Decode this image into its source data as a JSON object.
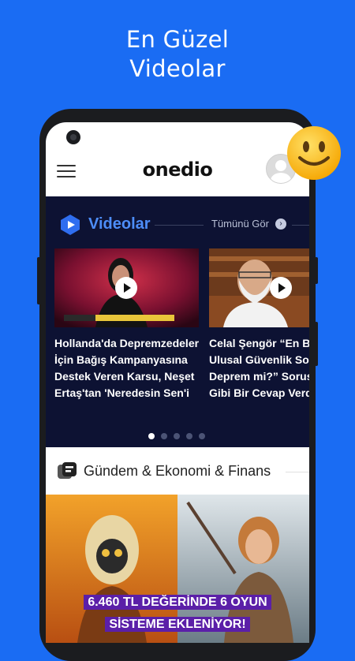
{
  "promo": {
    "line1": "En Güzel",
    "line2": "Videolar"
  },
  "app": {
    "logo": "onedio"
  },
  "videos": {
    "section_title": "Videolar",
    "see_all": "Tümünü Gör",
    "items": [
      {
        "title_lines": [
          "Hollanda'da Depremzedeler",
          "İçin Bağış Kampanyasına",
          "Destek Veren Karsu, Neşet",
          "Ertaş'tan 'Neredesin Sen'i"
        ]
      },
      {
        "title_lines": [
          "Celal Şengör “En Büyük",
          "Ulusal Güvenlik Sorunu",
          "Deprem mi?” Sorusuna",
          "Gibi Bir Cevap Verdi!"
        ]
      }
    ],
    "pager": {
      "count": 5,
      "active": 0
    }
  },
  "category": {
    "title": "Gündem & Ekonomi & Finans"
  },
  "banner": {
    "line1": "6.460 TL DEĞERİNDE 6 OYUN",
    "line2": "SİSTEME EKLENİYOR!"
  },
  "colors": {
    "background": "#1a6cf3",
    "section_dark": "#0d1233",
    "accent": "#4d8df8",
    "caption_bg": "#5b1fa8"
  }
}
